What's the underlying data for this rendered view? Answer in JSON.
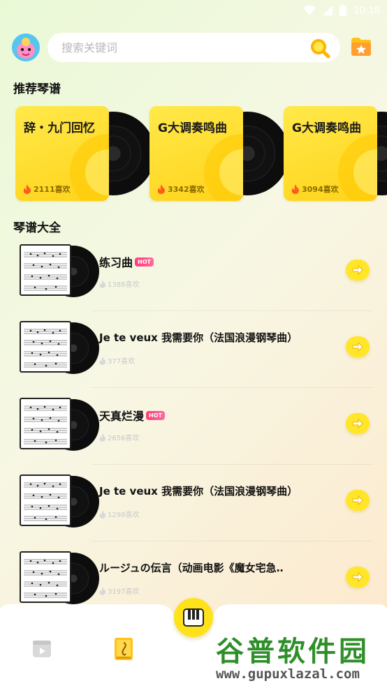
{
  "status_bar": {
    "time": "10:18"
  },
  "search": {
    "placeholder": "搜索关键词",
    "value": ""
  },
  "sections": {
    "recommended": "推荐琴谱",
    "all": "琴谱大全"
  },
  "featured": [
    {
      "title": "辞・九门回忆",
      "likes": "2111喜欢"
    },
    {
      "title": "G大调奏鸣曲",
      "likes": "3342喜欢"
    },
    {
      "title": "G大调奏鸣曲",
      "likes": "3094喜欢"
    }
  ],
  "list": [
    {
      "title": "练习曲",
      "hot": true,
      "hot_label": "HOT",
      "likes": "1388喜欢"
    },
    {
      "title": "Je te veux 我需要你（法国浪漫钢琴曲）",
      "hot": false,
      "hot_label": "",
      "likes": "377喜欢"
    },
    {
      "title": "天真烂漫",
      "hot": true,
      "hot_label": "HOT",
      "likes": "2656喜欢"
    },
    {
      "title": "Je te veux 我需要你（法国浪漫钢琴曲）",
      "hot": false,
      "hot_label": "",
      "likes": "1298喜欢"
    },
    {
      "title": "ルージュの伝言（动画电影《魔女宅急‥",
      "hot": false,
      "hot_label": "",
      "likes": "3197喜欢"
    }
  ],
  "watermark": {
    "cn": "谷普软件园",
    "en": "www.gupuxlazal.com"
  },
  "colors": {
    "accent": "#ffe21a",
    "hot": "#ff3c7b",
    "watermark_green": "#2f8f2a"
  },
  "icons": [
    "wifi-icon",
    "signal-icon",
    "battery-icon",
    "search-icon",
    "favorites-icon",
    "flame-icon",
    "arrow-right-icon",
    "piano-icon",
    "video-icon",
    "score-book-icon"
  ]
}
